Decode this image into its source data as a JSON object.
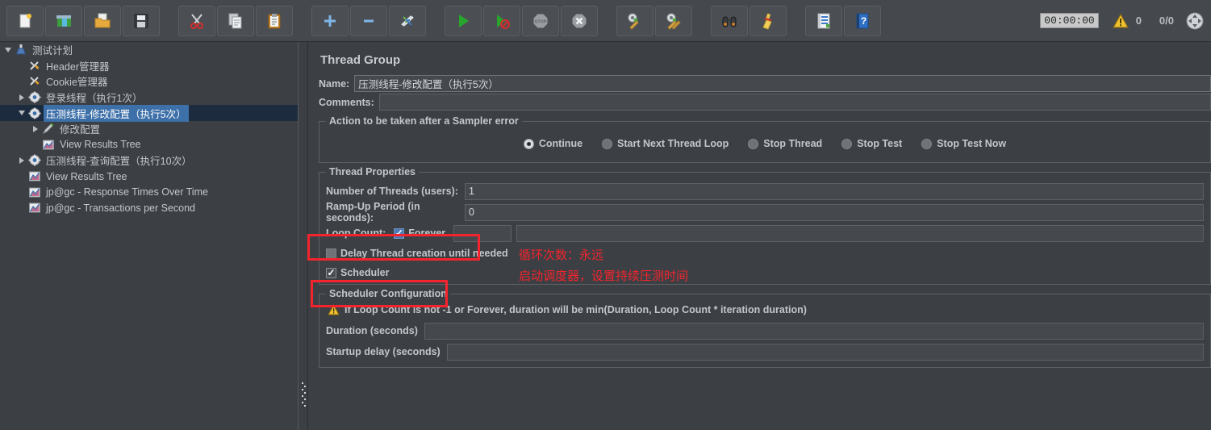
{
  "toolbar": {
    "groups": [
      [
        {
          "name": "new-test-plan-button",
          "icon": "new-document-icon",
          "tooltip": "New"
        },
        {
          "name": "templates-button",
          "icon": "templates-icon",
          "tooltip": "Templates"
        },
        {
          "name": "open-button",
          "icon": "open-folder-icon",
          "tooltip": "Open"
        },
        {
          "name": "save-button",
          "icon": "floppy-save-icon",
          "tooltip": "Save"
        }
      ],
      [
        {
          "name": "cut-button",
          "icon": "scissors-icon",
          "tooltip": "Cut"
        },
        {
          "name": "copy-button",
          "icon": "copy-pages-icon",
          "tooltip": "Copy"
        },
        {
          "name": "paste-button",
          "icon": "clipboard-paste-icon",
          "tooltip": "Paste"
        }
      ],
      [
        {
          "name": "expand-all-button",
          "icon": "plus-icon",
          "tooltip": "Expand All"
        },
        {
          "name": "collapse-all-button",
          "icon": "minus-icon",
          "tooltip": "Collapse All"
        },
        {
          "name": "toggle-button",
          "icon": "toggle-pencils-icon",
          "tooltip": "Toggle"
        }
      ],
      [
        {
          "name": "start-button",
          "icon": "green-play-icon",
          "tooltip": "Start"
        },
        {
          "name": "start-no-pauses-button",
          "icon": "green-play-no-pause-icon",
          "tooltip": "Start no pauses"
        },
        {
          "name": "stop-button",
          "icon": "stop-sign-icon",
          "tooltip": "Stop"
        },
        {
          "name": "shutdown-button",
          "icon": "shutdown-x-icon",
          "tooltip": "Shutdown"
        }
      ],
      [
        {
          "name": "clear-button",
          "icon": "gear-broom-icon",
          "tooltip": "Clear"
        },
        {
          "name": "clear-all-button",
          "icon": "gears-broom-icon",
          "tooltip": "Clear All"
        }
      ],
      [
        {
          "name": "search-button",
          "icon": "binoculars-icon",
          "tooltip": "Search"
        },
        {
          "name": "reset-search-button",
          "icon": "broom-icon",
          "tooltip": "Reset Search"
        }
      ],
      [
        {
          "name": "function-helper-button",
          "icon": "notepad-list-icon",
          "tooltip": "Function Helper Dialog"
        },
        {
          "name": "help-button",
          "icon": "blue-help-book-icon",
          "tooltip": "Help"
        }
      ]
    ],
    "timer": "00:00:00",
    "warning_count": "0",
    "thread_counter": "0/0",
    "expand_icon": "four-arrows-expand-icon"
  },
  "tree": {
    "items": [
      {
        "label": "测试计划",
        "indent": 0,
        "twisty": "down",
        "icon": "test-plan-icon",
        "selected": false
      },
      {
        "label": "Header管理器",
        "indent": 1,
        "twisty": "none",
        "icon": "config-wrench-icon",
        "selected": false
      },
      {
        "label": "Cookie管理器",
        "indent": 1,
        "twisty": "none",
        "icon": "config-wrench-icon",
        "selected": false
      },
      {
        "label": "登录线程（执行1次）",
        "indent": 1,
        "twisty": "right",
        "icon": "thread-group-icon",
        "selected": false
      },
      {
        "label": "压测线程-修改配置（执行5次）",
        "indent": 1,
        "twisty": "down",
        "icon": "thread-group-icon",
        "selected": true
      },
      {
        "label": "修改配置",
        "indent": 2,
        "twisty": "right",
        "icon": "sampler-pen-icon",
        "selected": false
      },
      {
        "label": "View Results Tree",
        "indent": 2,
        "twisty": "none",
        "icon": "listener-chart-icon",
        "selected": false
      },
      {
        "label": "压测线程-查询配置（执行10次）",
        "indent": 1,
        "twisty": "right",
        "icon": "thread-group-icon",
        "selected": false
      },
      {
        "label": "View Results Tree",
        "indent": 1,
        "twisty": "none",
        "icon": "listener-chart-icon",
        "selected": false
      },
      {
        "label": "jp@gc - Response Times Over Time",
        "indent": 1,
        "twisty": "none",
        "icon": "listener-chart-icon",
        "selected": false
      },
      {
        "label": "jp@gc - Transactions per Second",
        "indent": 1,
        "twisty": "none",
        "icon": "listener-chart-icon",
        "selected": false
      }
    ]
  },
  "main": {
    "title": "Thread Group",
    "name_label": "Name:",
    "name_value": "压测线程-修改配置（执行5次）",
    "comments_label": "Comments:",
    "comments_value": "",
    "sampler_error": {
      "legend": "Action to be taken after a Sampler error",
      "options": [
        {
          "label": "Continue",
          "selected": true
        },
        {
          "label": "Start Next Thread Loop",
          "selected": false
        },
        {
          "label": "Stop Thread",
          "selected": false
        },
        {
          "label": "Stop Test",
          "selected": false
        },
        {
          "label": "Stop Test Now",
          "selected": false
        }
      ]
    },
    "thread_properties": {
      "legend": "Thread Properties",
      "num_threads_label": "Number of Threads (users):",
      "num_threads_value": "1",
      "ramp_up_label": "Ramp-Up Period (in seconds):",
      "ramp_up_value": "0",
      "loop_count_label": "Loop Count:",
      "forever_label": "Forever",
      "forever_checked": true,
      "loop_count_value": "",
      "delay_thread_label": "Delay Thread creation until needed",
      "delay_thread_checked": false,
      "scheduler_label": "Scheduler",
      "scheduler_checked": true
    },
    "scheduler_config": {
      "legend": "Scheduler Configuration",
      "warning_icon": "warning-triangle-icon",
      "warning_text": "If Loop Count is not -1 or Forever, duration will be min(Duration, Loop Count * iteration duration)",
      "duration_label": "Duration (seconds)",
      "duration_value": "",
      "startup_delay_label": "Startup delay (seconds)",
      "startup_delay_value": ""
    }
  },
  "annotations": {
    "color": "#f5232d",
    "loop_count_note": "循环次数：永远",
    "scheduler_note": "启动调度器，设置持续压测时间"
  }
}
